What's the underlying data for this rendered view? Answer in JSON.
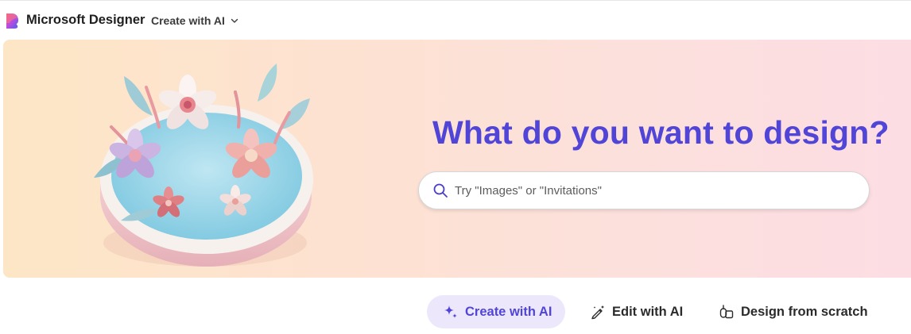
{
  "app": {
    "brand": "Microsoft Designer",
    "logo_icon": "microsoft-designer-logo"
  },
  "header": {
    "menu_label": "Create with AI",
    "menu_icon": "chevron-down-icon"
  },
  "hero": {
    "title": "What do you want to design?",
    "illustration": "paper-flowers-platform-illustration",
    "search": {
      "placeholder": "Try \"Images\" or \"Invitations\"",
      "value": "",
      "icon": "search-icon"
    }
  },
  "tabs": [
    {
      "label": "Create with AI",
      "icon": "sparkle-icon",
      "active": true
    },
    {
      "label": "Edit with AI",
      "icon": "magic-pen-icon",
      "active": false
    },
    {
      "label": "Design from scratch",
      "icon": "shapes-icon",
      "active": false
    }
  ],
  "colors": {
    "accent": "#5145d8",
    "active_tab_bg": "#ece7fb",
    "hero_gradient_start": "#fde6c6",
    "hero_gradient_end": "#fcdde4"
  }
}
